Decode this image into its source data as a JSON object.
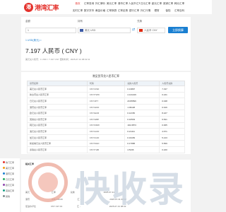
{
  "brand": {
    "logo_glyph": "港",
    "name": "港湾汇率",
    "accent": "#e4322c",
    "link_color": "#1a7fd1"
  },
  "nav": {
    "row1": [
      "首页",
      "汇率查询",
      "外汇牌价",
      "美元汇率",
      "港币汇率",
      "人民币汇率",
      "日元汇率",
      "欧元汇率",
      "英镑汇率",
      "韩元汇率"
    ],
    "row2": [
      "实时汇率",
      "数字货币",
      "黄金价格",
      "汇率换算",
      "汇率走势",
      "银行汇率",
      "外汇行情",
      "理财",
      "保险",
      "汇率百科"
    ]
  },
  "converter": {
    "amount_label": "金额",
    "amount_value": "1",
    "from_label": "持有",
    "from_value": "美元 USD",
    "to_label": "兑换",
    "to_value": "人民币 CNY",
    "button": "立即换算"
  },
  "result": {
    "small_line": "1 USD(美元) =",
    "big_line": "7.197 人民币 ( CNY )",
    "meta": "美元兑人民币：1 USD = 7.197 CNY   更新时间：2025-07-31 08:02:11"
  },
  "table": {
    "title": "常见货币兑人民币汇率",
    "headers": [
      "货币名称",
      "代码",
      "兑换人民币",
      "人民币兑换"
    ],
    "rows": [
      [
        "美元兑人民币汇率",
        "CNY/USD",
        "0.13897",
        "7.197"
      ],
      [
        "新台币兑人民币汇率",
        "CNY/TWD",
        "4.141449",
        "0.241"
      ],
      [
        "日元兑人民币汇率",
        "CNY/JPY",
        "20.86596",
        "0.048"
      ],
      [
        "港币兑人民币汇率",
        "CNY/HKD",
        "1.09148",
        "0.916"
      ],
      [
        "欧元兑人民币汇率",
        "CNY/EUR",
        "0.12156",
        "8.227"
      ],
      [
        "英镑兑人民币汇率",
        "CNY/GBP",
        "0.10503",
        "9.521"
      ],
      [
        "韩元兑人民币汇率",
        "CNY/KRW",
        "192.0873",
        "0.005"
      ],
      [
        "澳元兑人民币汇率",
        "CNY/AUD",
        "0.21411",
        "4.671"
      ],
      [
        "加元兑人民币汇率",
        "CNY/CAD",
        "0.19183",
        "5.213"
      ],
      [
        "新加坡元兑人民币汇率",
        "CNY/SGD",
        "0.17958",
        "5.569"
      ],
      [
        "泰铢兑人民币汇率",
        "CNY/THB",
        "4.5436",
        "0.220"
      ]
    ]
  },
  "sidebar": [
    "热门汇率",
    "美元汇率",
    "港币汇率",
    "日元汇率",
    "欧元汇率",
    "英镑汇率",
    "其他"
  ],
  "lower": {
    "rows": [
      [
        "相关汇率",
        "",
        "",
        ""
      ],
      [
        "美元",
        "汇率",
        "兑换",
        "2025-07-31"
      ],
      [
        "港币",
        "HK$ 139.09",
        "汇 -",
        "2025-07-31 08:02"
      ],
      [
        "尼泊尔卢比",
        "CNY 197.19",
        "汇 -",
        "2025-07-31 08:02"
      ]
    ]
  },
  "watermark": {
    "text": "快收录"
  }
}
